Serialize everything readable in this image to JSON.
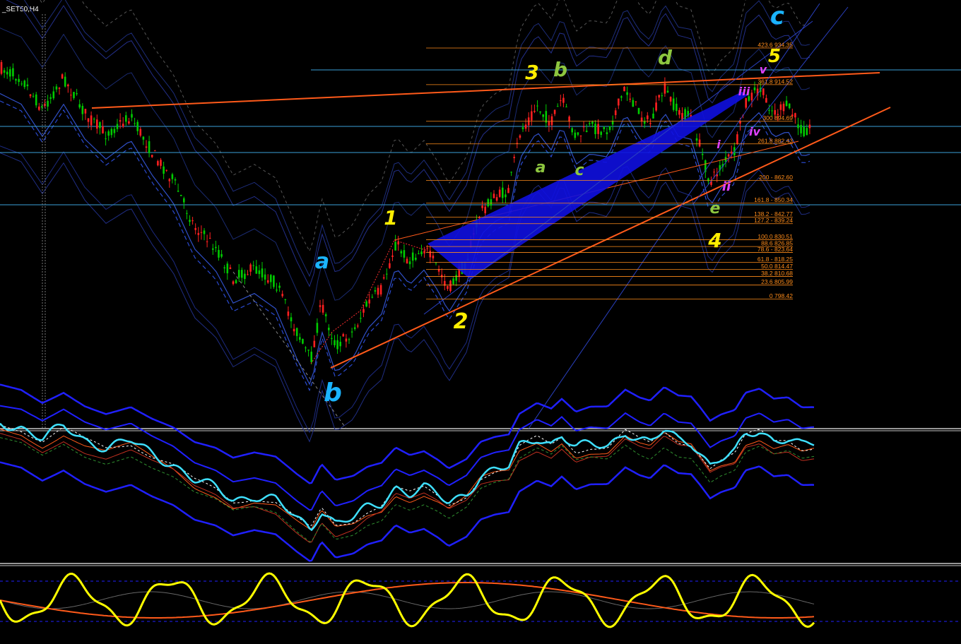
{
  "chart": {
    "symbol": "_SET50,H4"
  },
  "chart_data": {
    "type": "candlestick",
    "symbol": "_SET50,H4",
    "price_panel": {
      "fibonacci_levels": [
        {
          "ratio": "423.6",
          "price": 934.35,
          "label": "423.6 934.35"
        },
        {
          "ratio": "361.8",
          "price": 914.52,
          "label": "361.8 914.52"
        },
        {
          "ratio": "300",
          "price": 894.69,
          "label": "300 894.69"
        },
        {
          "ratio": "261.8",
          "price": 882.43,
          "label": "261.8 882.43"
        },
        {
          "ratio": "200",
          "price": 862.6,
          "label": "200 - 862.60"
        },
        {
          "ratio": "161.8",
          "price": 850.34,
          "label": "161.8 - 850.34"
        },
        {
          "ratio": "138.2",
          "price": 842.77,
          "label": "138.2 - 842.77"
        },
        {
          "ratio": "127.2",
          "price": 839.24,
          "label": "127.2 - 839.24"
        },
        {
          "ratio": "100.0",
          "price": 830.51,
          "label": "100.0 830.51"
        },
        {
          "ratio": "88.6",
          "price": 826.85,
          "label": "88.6 826.85"
        },
        {
          "ratio": "78.6",
          "price": 823.64,
          "label": "78.6 - 823.64"
        },
        {
          "ratio": "61.8",
          "price": 818.25,
          "label": "61.8 - 818.25"
        },
        {
          "ratio": "50.0",
          "price": 814.47,
          "label": "50.0 814.47"
        },
        {
          "ratio": "38.2",
          "price": 810.68,
          "label": "38.2 810.68"
        },
        {
          "ratio": "23.6",
          "price": 805.99,
          "label": "23.6 805.99"
        },
        {
          "ratio": "0",
          "price": 798.42,
          "label": "0 798.42"
        }
      ],
      "wave_labels": [
        {
          "text": "c",
          "color": "#1ab4ff"
        },
        {
          "text": "a",
          "color": "#1ab4ff"
        },
        {
          "text": "b",
          "color": "#1ab4ff"
        },
        {
          "text": "1",
          "color": "#ffee00"
        },
        {
          "text": "2",
          "color": "#ffee00"
        },
        {
          "text": "3",
          "color": "#ffee00"
        },
        {
          "text": "4",
          "color": "#ffee00"
        },
        {
          "text": "5",
          "color": "#ffee00"
        },
        {
          "text": "b",
          "color": "#8dc63f"
        },
        {
          "text": "d",
          "color": "#8dc63f"
        },
        {
          "text": "a",
          "color": "#8dc63f"
        },
        {
          "text": "c",
          "color": "#8dc63f"
        },
        {
          "text": "e",
          "color": "#8dc63f"
        },
        {
          "text": "v",
          "color": "#e040fb"
        },
        {
          "text": "iii",
          "color": "#e040fb"
        },
        {
          "text": "iv",
          "color": "#e040fb"
        },
        {
          "text": "i",
          "color": "#e040fb"
        },
        {
          "text": "ii",
          "color": "#e040fb"
        }
      ]
    },
    "indicator_panels": [
      {
        "name": "",
        "description": "oscillator with bands"
      },
      {
        "name": "",
        "description": "oscillator"
      }
    ],
    "colors": {
      "background": "#000000",
      "bull_candle": "#00cc00",
      "bear_candle": "#ff2020",
      "trendline": "#ff5a1a",
      "fib": "#ff8c1a",
      "channel": "#1a1aff",
      "hline": "#3aa0d8",
      "osc_main": "#3fe0ff",
      "osc2_main": "#ffff00"
    }
  }
}
